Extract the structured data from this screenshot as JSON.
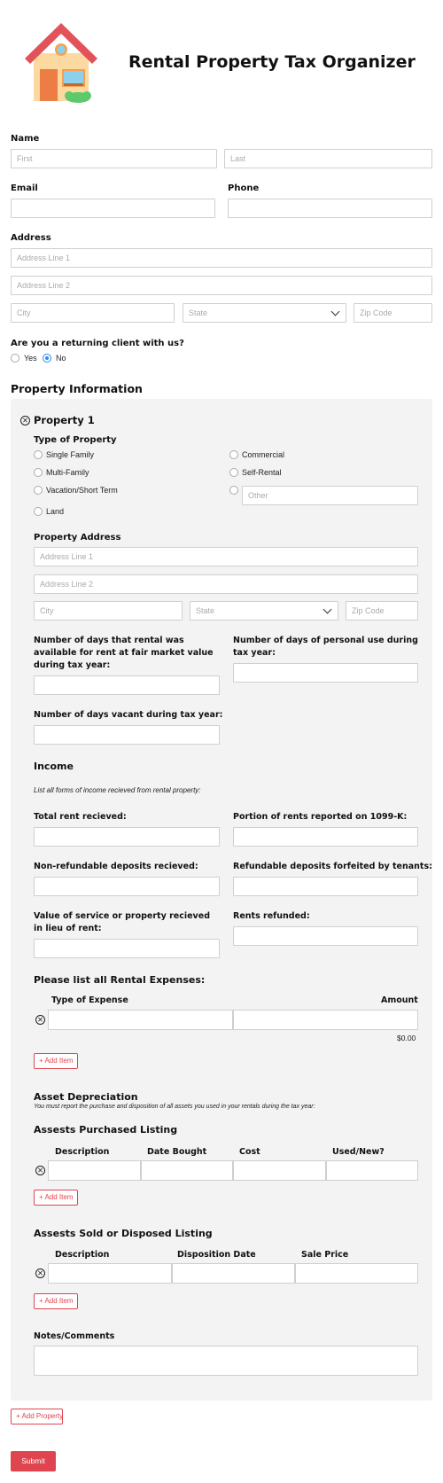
{
  "header": {
    "title": "Rental Property Tax Organizer"
  },
  "name": {
    "label": "Name",
    "first_placeholder": "First",
    "last_placeholder": "Last"
  },
  "email": {
    "label": "Email"
  },
  "phone": {
    "label": "Phone"
  },
  "address": {
    "label": "Address",
    "line1": "Address Line 1",
    "line2": "Address Line 2",
    "city": "City",
    "state": "State",
    "zip": "Zip Code"
  },
  "returning": {
    "question": "Are you a returning client with us?",
    "options": [
      "Yes",
      "No"
    ],
    "selected": "No"
  },
  "property_info": {
    "title": "Property Information"
  },
  "property": {
    "title": "Property 1",
    "type_label": "Type of Property",
    "types_left": [
      "Single Family",
      "Multi-Family",
      "Vacation/Short Term",
      "Land"
    ],
    "types_right": [
      "Commercial",
      "Self-Rental"
    ],
    "other_placeholder": "Other",
    "address_label": "Property Address",
    "days_fmv_label": "Number of days that rental was available for rent at fair market value during tax year:",
    "days_personal_label": "Number of days of personal use during tax year:",
    "days_vacant_label": "Number of days vacant during tax year:"
  },
  "income": {
    "title": "Income",
    "note": "List all forms of income recieved from rental property:",
    "total_rent": "Total rent recieved:",
    "portion_1099": "Portion of rents reported on 1099-K:",
    "nonrefundable": "Non-refundable deposits recieved:",
    "refundable": "Refundable deposits forfeited by tenants:",
    "service_value": "Value of service or property recieved in lieu of rent:",
    "refunded": "Rents refunded:"
  },
  "expenses": {
    "title": "Please list all Rental Expenses:",
    "col_type": "Type of Expense",
    "col_amount": "Amount",
    "total": "$0.00",
    "add_label": "Add Item"
  },
  "depreciation": {
    "title": "Asset Depreciation",
    "note": "You must report the purchase and disposition of all assets you used in your rentals during the tax year:"
  },
  "purchased": {
    "title": "Assests Purchased Listing",
    "cols": [
      "Description",
      "Date Bought",
      "Cost",
      "Used/New?"
    ],
    "add_label": "Add Item"
  },
  "sold": {
    "title": "Assests Sold or Disposed Listing",
    "cols": [
      "Description",
      "Disposition Date",
      "Sale Price"
    ],
    "add_label": "Add Item"
  },
  "notes": {
    "label": "Notes/Comments"
  },
  "add_property": "Add Property",
  "submit": "Submit",
  "icons": {
    "remove": "remove-circle-icon",
    "add": "plus-icon",
    "house": "house-icon",
    "chevron": "chevron-down-icon"
  },
  "colors": {
    "accent": "#e0454f",
    "radio_selected": "#2a8bf2",
    "panel_bg": "#f3f3f3"
  }
}
